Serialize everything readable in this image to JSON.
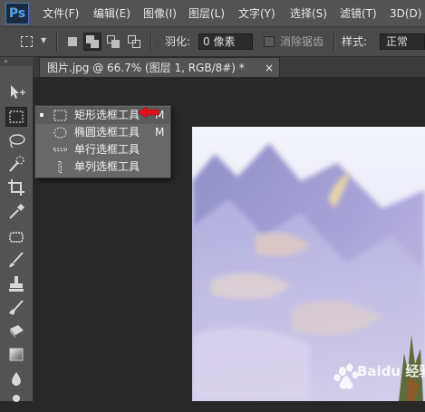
{
  "app": {
    "logo": "Ps"
  },
  "menubar": {
    "items": [
      {
        "label": "文件(F)"
      },
      {
        "label": "编辑(E)"
      },
      {
        "label": "图像(I)"
      },
      {
        "label": "图层(L)"
      },
      {
        "label": "文字(Y)"
      },
      {
        "label": "选择(S)"
      },
      {
        "label": "滤镜(T)"
      },
      {
        "label": "3D(D)"
      }
    ]
  },
  "options_bar": {
    "feather_label": "羽化:",
    "feather_value": "0 像素",
    "antialias_label": "消除锯齿",
    "style_label": "样式:",
    "style_value": "正常"
  },
  "toolbar": {
    "grip": "»",
    "tools": [
      {
        "icon": "move-icon"
      },
      {
        "icon": "rect-marquee-icon",
        "active": true
      },
      {
        "icon": "lasso-icon"
      },
      {
        "icon": "quick-select-icon"
      },
      {
        "icon": "crop-icon"
      },
      {
        "icon": "eyedropper-icon"
      },
      {
        "icon": "spot-healing-icon"
      },
      {
        "icon": "brush-icon"
      },
      {
        "icon": "clone-stamp-icon"
      },
      {
        "icon": "history-brush-icon"
      },
      {
        "icon": "eraser-icon"
      },
      {
        "icon": "gradient-icon"
      },
      {
        "icon": "blur-icon"
      },
      {
        "icon": "dodge-icon"
      }
    ]
  },
  "document": {
    "tab_title": "图片.jpg @ 66.7% (图层 1, RGB/8#) *",
    "close": "×"
  },
  "flyout": {
    "items": [
      {
        "label": "矩形选框工具",
        "shortcut": "M",
        "selected": true,
        "icon": "rect-marquee-icon"
      },
      {
        "label": "椭圆选框工具",
        "shortcut": "M",
        "selected": false,
        "icon": "ellipse-marquee-icon"
      },
      {
        "label": "单行选框工具",
        "shortcut": "",
        "selected": false,
        "icon": "single-row-marquee-icon"
      },
      {
        "label": "单列选框工具",
        "shortcut": "",
        "selected": false,
        "icon": "single-column-marquee-icon"
      }
    ]
  },
  "watermark": {
    "text": "Baidu 经验"
  },
  "colors": {
    "accent": "#4fa3ea",
    "arrow": "#e3101a",
    "menubar": "#535353",
    "canvas_bg": "#282828"
  }
}
